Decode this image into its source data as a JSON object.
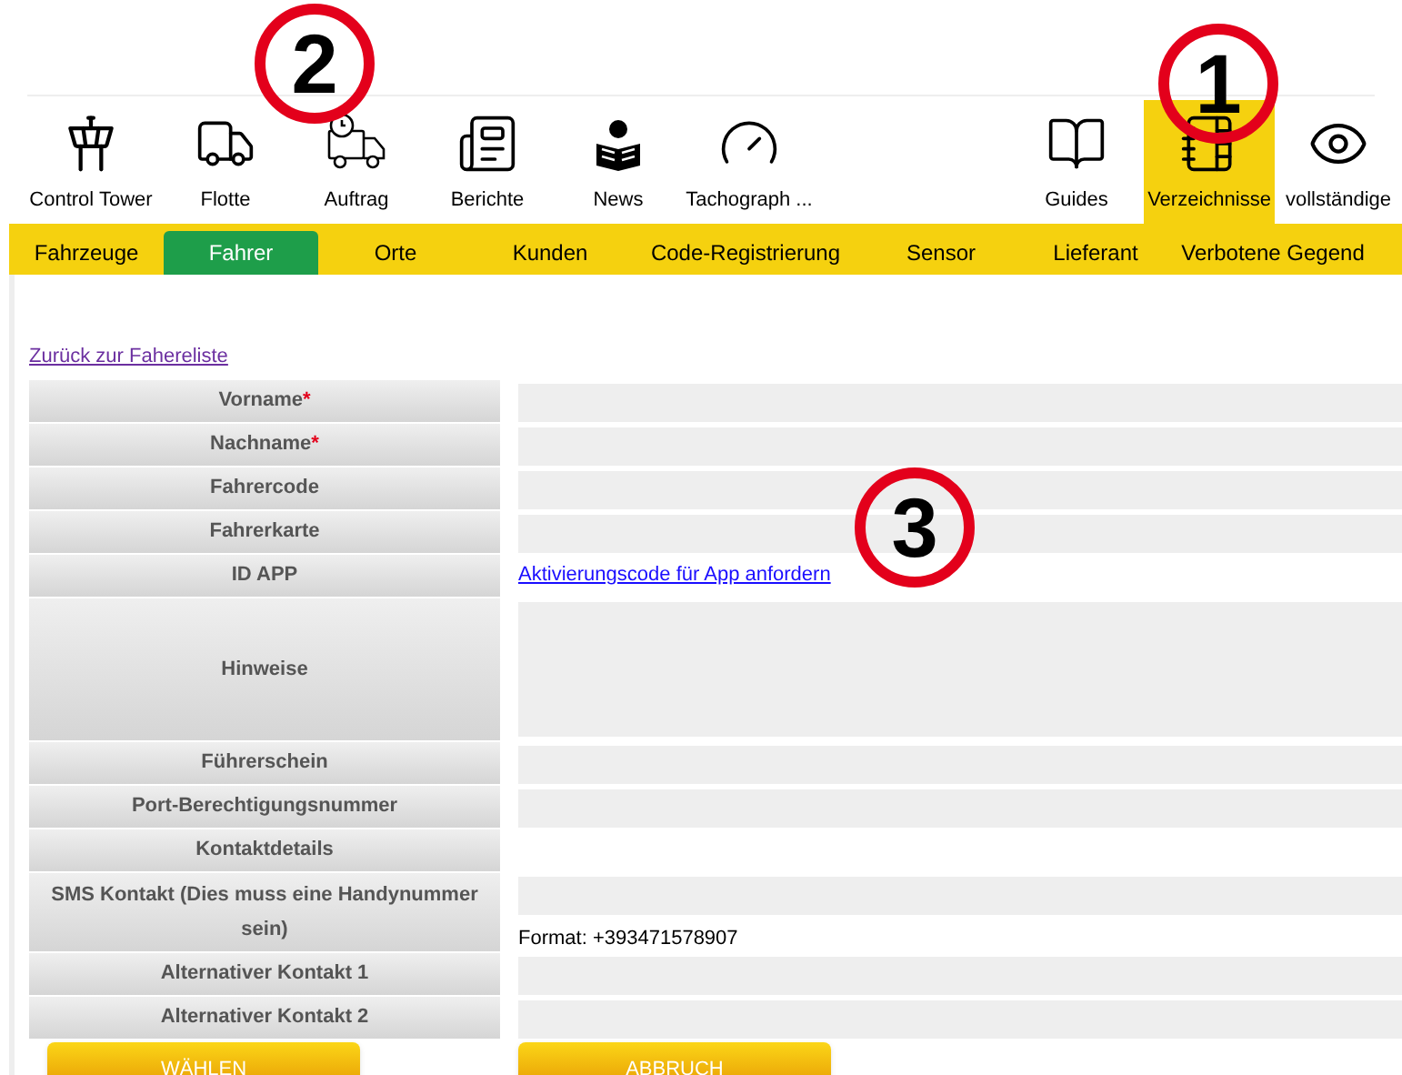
{
  "nav_items": [
    {
      "label": "Control Tower",
      "selected": false
    },
    {
      "label": "Flotte",
      "selected": false
    },
    {
      "label": "Auftrag",
      "selected": false
    },
    {
      "label": "Berichte",
      "selected": false
    },
    {
      "label": "News",
      "selected": false
    },
    {
      "label": "Tachograph ...",
      "selected": false
    },
    {
      "label": "Guides",
      "selected": false
    },
    {
      "label": "Verzeichnisse",
      "selected": true
    },
    {
      "label": "vollständige",
      "selected": false
    }
  ],
  "tabs": [
    {
      "label": "Fahrzeuge",
      "selected": false
    },
    {
      "label": "Fahrer",
      "selected": true
    },
    {
      "label": "Orte",
      "selected": false
    },
    {
      "label": "Kunden",
      "selected": false
    },
    {
      "label": "Code-Registrierung",
      "selected": false
    },
    {
      "label": "Sensor",
      "selected": false
    },
    {
      "label": "Lieferant",
      "selected": false
    },
    {
      "label": "Verbotene Gegend",
      "selected": false
    }
  ],
  "back_link": "Zurück zur Fahereliste",
  "form_rows": [
    {
      "label": "Vorname",
      "required_mark": "*",
      "kind": "input"
    },
    {
      "label": "Nachname",
      "required_mark": "*",
      "kind": "input"
    },
    {
      "label": "Fahrercode",
      "kind": "input"
    },
    {
      "label": "Fahrerkarte",
      "kind": "input"
    },
    {
      "label": "ID APP",
      "kind": "link",
      "link": "Aktivierungscode für App anfordern"
    },
    {
      "label": "Hinweise",
      "kind": "textarea"
    },
    {
      "label": "Führerschein",
      "kind": "input"
    },
    {
      "label": "Port-Berechtigungsnummer",
      "kind": "input"
    },
    {
      "label": "Kontaktdetails",
      "kind": "heading"
    },
    {
      "label": "SMS Kontakt (Dies muss eine Handynummer sein)",
      "kind": "input",
      "hint": "Format: +393471578907"
    },
    {
      "label": "Alternativer Kontakt 1",
      "kind": "input"
    },
    {
      "label": "Alternativer Kontakt 2",
      "kind": "input"
    }
  ],
  "buttons": [
    "WÄHLEN",
    "ABBRUCH"
  ],
  "annotations": [
    "1",
    "2",
    "3"
  ]
}
